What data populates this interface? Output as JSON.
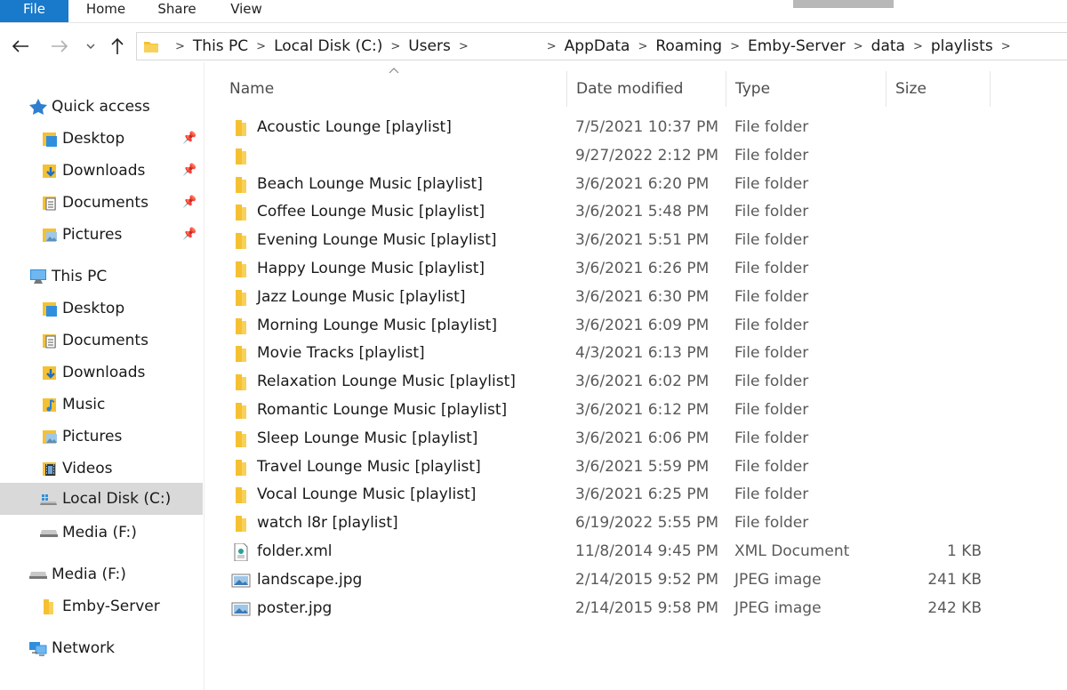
{
  "ribbon": {
    "tabs": [
      "File",
      "Home",
      "Share",
      "View"
    ]
  },
  "address": {
    "crumbs": [
      "This PC",
      "Local Disk (C:)",
      "Users",
      "AppData",
      "Roaming",
      "Emby-Server",
      "data",
      "playlists"
    ]
  },
  "navpane": {
    "quick_access": "Quick access",
    "quick_items": [
      "Desktop",
      "Downloads",
      "Documents",
      "Pictures"
    ],
    "this_pc": "This PC",
    "pc_items": [
      "Desktop",
      "Documents",
      "Downloads",
      "Music",
      "Pictures",
      "Videos",
      "Local Disk (C:)",
      "Media (F:)"
    ],
    "media": "Media (F:)",
    "emby": "Emby-Server",
    "network": "Network"
  },
  "columns": {
    "name": "Name",
    "date": "Date modified",
    "type": "Type",
    "size": "Size"
  },
  "files": [
    {
      "name": "Acoustic Lounge [playlist]",
      "date": "7/5/2021 10:37 PM",
      "type": "File folder",
      "size": "",
      "icon": "folder-icon"
    },
    {
      "name": "",
      "date": "9/27/2022 2:12 PM",
      "type": "File folder",
      "size": "",
      "icon": "folder-icon"
    },
    {
      "name": "Beach Lounge Music [playlist]",
      "date": "3/6/2021 6:20 PM",
      "type": "File folder",
      "size": "",
      "icon": "folder-icon"
    },
    {
      "name": "Coffee Lounge Music [playlist]",
      "date": "3/6/2021 5:48 PM",
      "type": "File folder",
      "size": "",
      "icon": "folder-icon"
    },
    {
      "name": "Evening Lounge Music [playlist]",
      "date": "3/6/2021 5:51 PM",
      "type": "File folder",
      "size": "",
      "icon": "folder-icon"
    },
    {
      "name": "Happy Lounge Music [playlist]",
      "date": "3/6/2021 6:26 PM",
      "type": "File folder",
      "size": "",
      "icon": "folder-icon"
    },
    {
      "name": "Jazz Lounge Music [playlist]",
      "date": "3/6/2021 6:30 PM",
      "type": "File folder",
      "size": "",
      "icon": "folder-icon"
    },
    {
      "name": "Morning Lounge Music [playlist]",
      "date": "3/6/2021 6:09 PM",
      "type": "File folder",
      "size": "",
      "icon": "folder-icon"
    },
    {
      "name": "Movie Tracks [playlist]",
      "date": "4/3/2021 6:13 PM",
      "type": "File folder",
      "size": "",
      "icon": "folder-icon"
    },
    {
      "name": "Relaxation Lounge Music [playlist]",
      "date": "3/6/2021 6:02 PM",
      "type": "File folder",
      "size": "",
      "icon": "folder-icon"
    },
    {
      "name": "Romantic Lounge Music [playlist]",
      "date": "3/6/2021 6:12 PM",
      "type": "File folder",
      "size": "",
      "icon": "folder-icon"
    },
    {
      "name": "Sleep Lounge Music [playlist]",
      "date": "3/6/2021 6:06 PM",
      "type": "File folder",
      "size": "",
      "icon": "folder-icon"
    },
    {
      "name": "Travel Lounge Music [playlist]",
      "date": "3/6/2021 5:59 PM",
      "type": "File folder",
      "size": "",
      "icon": "folder-icon"
    },
    {
      "name": "Vocal Lounge Music [playlist]",
      "date": "3/6/2021 6:25 PM",
      "type": "File folder",
      "size": "",
      "icon": "folder-icon"
    },
    {
      "name": "watch l8r [playlist]",
      "date": "6/19/2022 5:55 PM",
      "type": "File folder",
      "size": "",
      "icon": "folder-icon"
    },
    {
      "name": "folder.xml",
      "date": "11/8/2014 9:45 PM",
      "type": "XML Document",
      "size": "1 KB",
      "icon": "xml-file-icon"
    },
    {
      "name": "landscape.jpg",
      "date": "2/14/2015 9:52 PM",
      "type": "JPEG image",
      "size": "241 KB",
      "icon": "image-file-icon"
    },
    {
      "name": "poster.jpg",
      "date": "2/14/2015 9:58 PM",
      "type": "JPEG image",
      "size": "242 KB",
      "icon": "image-file-icon"
    }
  ],
  "colors": {
    "file_tab": "#1979ca",
    "folder": "#f5c132",
    "selected": "#d9d9d9"
  }
}
